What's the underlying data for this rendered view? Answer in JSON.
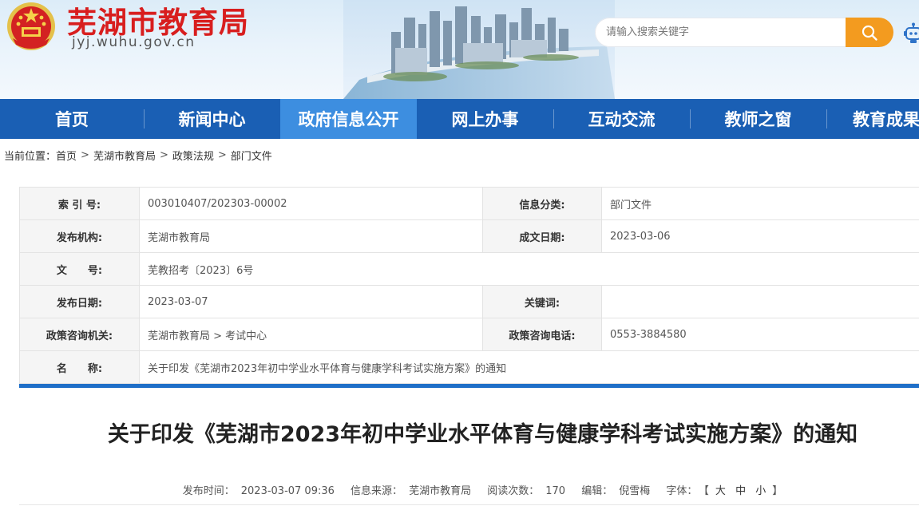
{
  "header": {
    "site_name": "芜湖市教育局",
    "domain": "jyj.wuhu.gov.cn",
    "search_placeholder": "请输入搜索关键字"
  },
  "nav": {
    "items": [
      "首页",
      "新闻中心",
      "政府信息公开",
      "网上办事",
      "互动交流",
      "教师之窗",
      "教育成果展"
    ],
    "active": "政府信息公开"
  },
  "breadcrumb": {
    "prefix": "当前位置：",
    "items": [
      "首页",
      "芜湖市教育局",
      "政策法规",
      "部门文件"
    ],
    "separator": ">"
  },
  "info": {
    "index_label": "索 引 号:",
    "index_value": "003010407/202303-00002",
    "category_label": "信息分类:",
    "category_value": "部门文件",
    "org_label": "发布机构:",
    "org_value": "芜湖市教育局",
    "date_made_label": "成文日期:",
    "date_made_value": "2023-03-06",
    "docno_label": "文　　号:",
    "docno_value": "芜教招考〔2023〕6号",
    "pub_date_label": "发布日期:",
    "pub_date_value": "2023-03-07",
    "keywords_label": "关键词:",
    "keywords_value": "",
    "consult_org_label": "政策咨询机关:",
    "consult_org_value": "芜湖市教育局 > 考试中心",
    "consult_phone_label": "政策咨询电话:",
    "consult_phone_value": "0553-3884580",
    "name_label": "名　　称:",
    "name_value": "关于印发《芜湖市2023年初中学业水平体育与健康学科考试实施方案》的通知"
  },
  "article": {
    "title": "关于印发《芜湖市2023年初中学业水平体育与健康学科考试实施方案》的通知",
    "publish_time_label": "发布时间：",
    "publish_time": "2023-03-07 09:36",
    "source_label": "信息来源：",
    "source": "芜湖市教育局",
    "views_label": "阅读次数：",
    "views": "170",
    "editor_label": "编辑：",
    "editor": "倪雪梅",
    "font_label": "字体：",
    "font_open": "【",
    "font_large": "大",
    "font_medium": "中",
    "font_small": "小",
    "font_close": "】"
  },
  "colors": {
    "nav_bg": "#1a5fb4",
    "nav_active": "#3d8ee0",
    "site_name": "#d81e1e",
    "search_button": "#f39b1f",
    "table_rule": "#1f6fc8"
  },
  "icons": {
    "emblem": "national-emblem-icon",
    "search": "search-icon",
    "assistant": "robot-icon"
  }
}
